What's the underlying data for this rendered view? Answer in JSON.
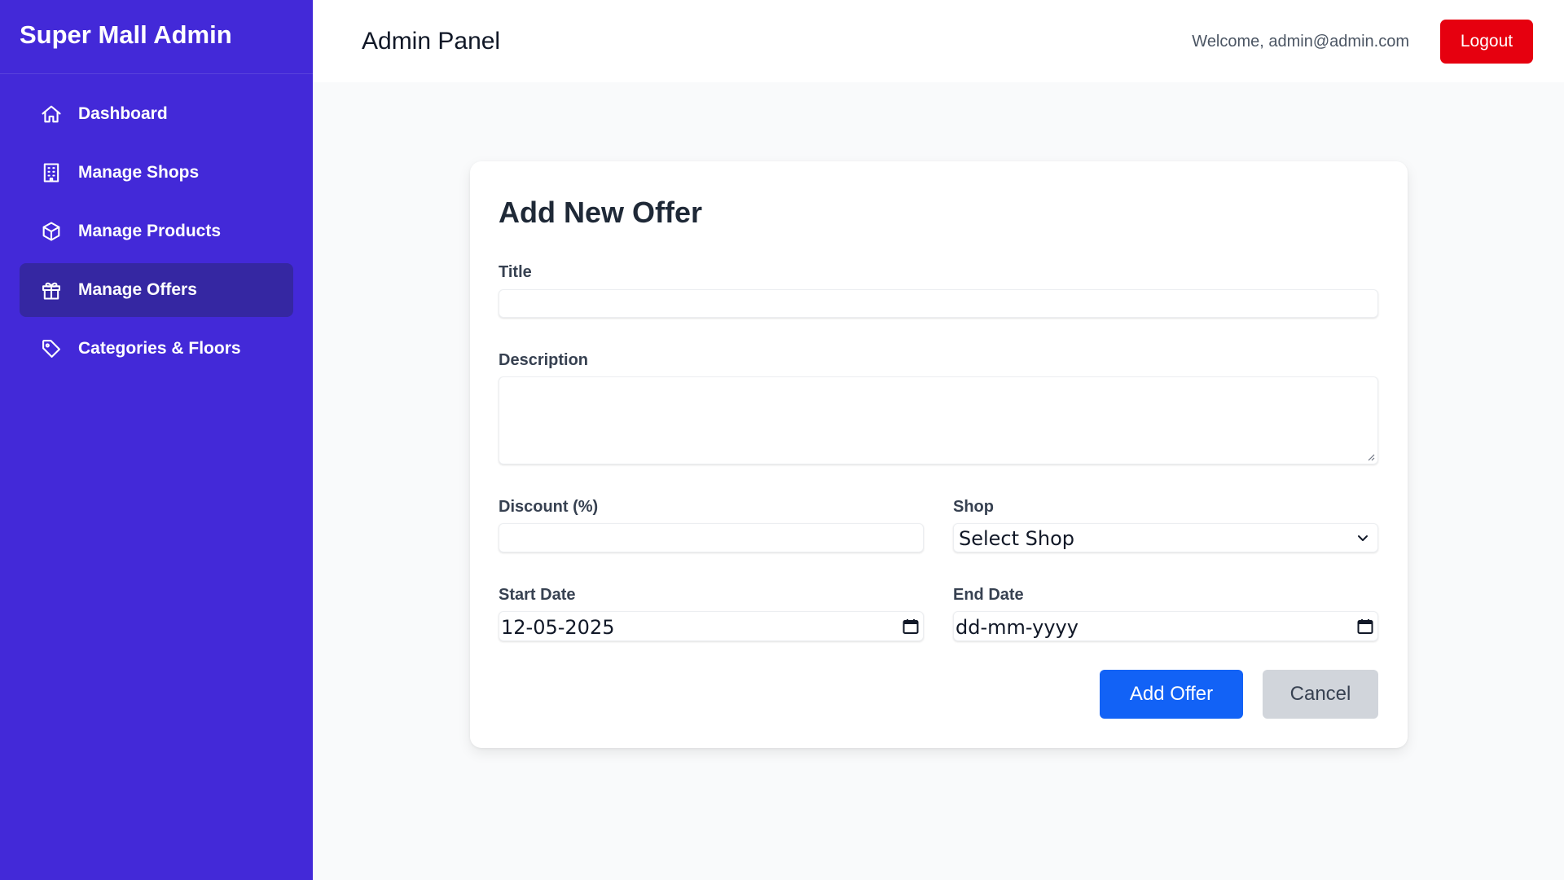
{
  "sidebar": {
    "brand": "Super Mall Admin",
    "items": [
      {
        "label": "Dashboard",
        "icon": "home-icon",
        "active": false
      },
      {
        "label": "Manage Shops",
        "icon": "building-icon",
        "active": false
      },
      {
        "label": "Manage Products",
        "icon": "cube-icon",
        "active": false
      },
      {
        "label": "Manage Offers",
        "icon": "gift-icon",
        "active": true
      },
      {
        "label": "Categories & Floors",
        "icon": "tag-icon",
        "active": false
      }
    ]
  },
  "header": {
    "title": "Admin Panel",
    "welcome": "Welcome, admin@admin.com",
    "logout_label": "Logout"
  },
  "form": {
    "heading": "Add New Offer",
    "title_label": "Title",
    "title_value": "",
    "description_label": "Description",
    "description_value": "",
    "discount_label": "Discount (%)",
    "discount_value": "",
    "shop_label": "Shop",
    "shop_selected": "Select Shop",
    "start_date_label": "Start Date",
    "start_date_value": "12-05-2025",
    "end_date_label": "End Date",
    "end_date_value": "dd-mm-yyyy",
    "submit_label": "Add Offer",
    "cancel_label": "Cancel"
  },
  "colors": {
    "sidebar_bg": "#4329d8",
    "sidebar_active": "#3527a2",
    "logout": "#e6000f",
    "primary": "#1262f6",
    "cancel": "#d1d5db"
  }
}
